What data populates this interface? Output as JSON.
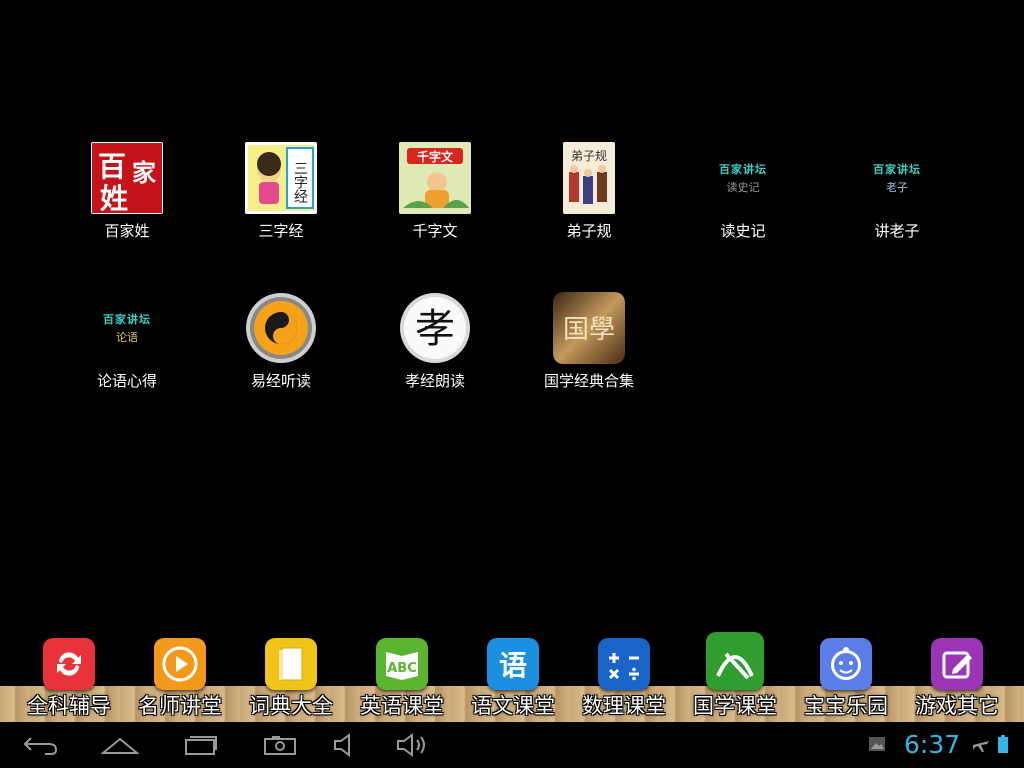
{
  "apps": [
    {
      "label": "百家姓",
      "icon": "baijiaxing-icon"
    },
    {
      "label": "三字经",
      "icon": "sanzijing-icon"
    },
    {
      "label": "千字文",
      "icon": "qianziwen-icon"
    },
    {
      "label": "弟子规",
      "icon": "diziGui-icon"
    },
    {
      "label": "读史记",
      "icon": "dushiji-icon"
    },
    {
      "label": "讲老子",
      "icon": "jianglaozi-icon"
    },
    {
      "label": "论语心得",
      "icon": "lunyu-icon"
    },
    {
      "label": "易经听读",
      "icon": "yijing-icon"
    },
    {
      "label": "孝经朗读",
      "icon": "xiaojing-icon"
    },
    {
      "label": "国学经典合集",
      "icon": "guoxue-collection-icon"
    }
  ],
  "icon_text": {
    "baijia_chars": [
      "百",
      "家",
      "姓"
    ],
    "sanzi_chars": "三字经",
    "qianzi_title": "千字文",
    "dizi_title": "弟子规",
    "banner": "百家讲坛",
    "shiji": "读史记",
    "laozi": "老子",
    "lunyu": "论语",
    "xiao": "孝",
    "guoxue": "国學"
  },
  "dock": [
    {
      "label": "全科辅导",
      "icon": "refresh-icon",
      "color": "#e8323c"
    },
    {
      "label": "名师讲堂",
      "icon": "play-icon",
      "color": "#f39a1c"
    },
    {
      "label": "词典大全",
      "icon": "book-icon",
      "color": "#f0c419"
    },
    {
      "label": "英语课堂",
      "icon": "abc-icon",
      "color": "#5cb531"
    },
    {
      "label": "语文课堂",
      "icon": "yu-icon",
      "color": "#1c8fe0"
    },
    {
      "label": "数理课堂",
      "icon": "math-icon",
      "color": "#1a63c7"
    },
    {
      "label": "国学课堂",
      "icon": "guoxue-icon",
      "color": "#2f9e2f"
    },
    {
      "label": "宝宝乐园",
      "icon": "baby-face-icon",
      "color": "#5b7ee6"
    },
    {
      "label": "游戏其它",
      "icon": "edit-icon",
      "color": "#9b35b6"
    }
  ],
  "dock_glyphs": {
    "yu": "语",
    "math": "+-×÷"
  },
  "status": {
    "time": "6:37"
  }
}
